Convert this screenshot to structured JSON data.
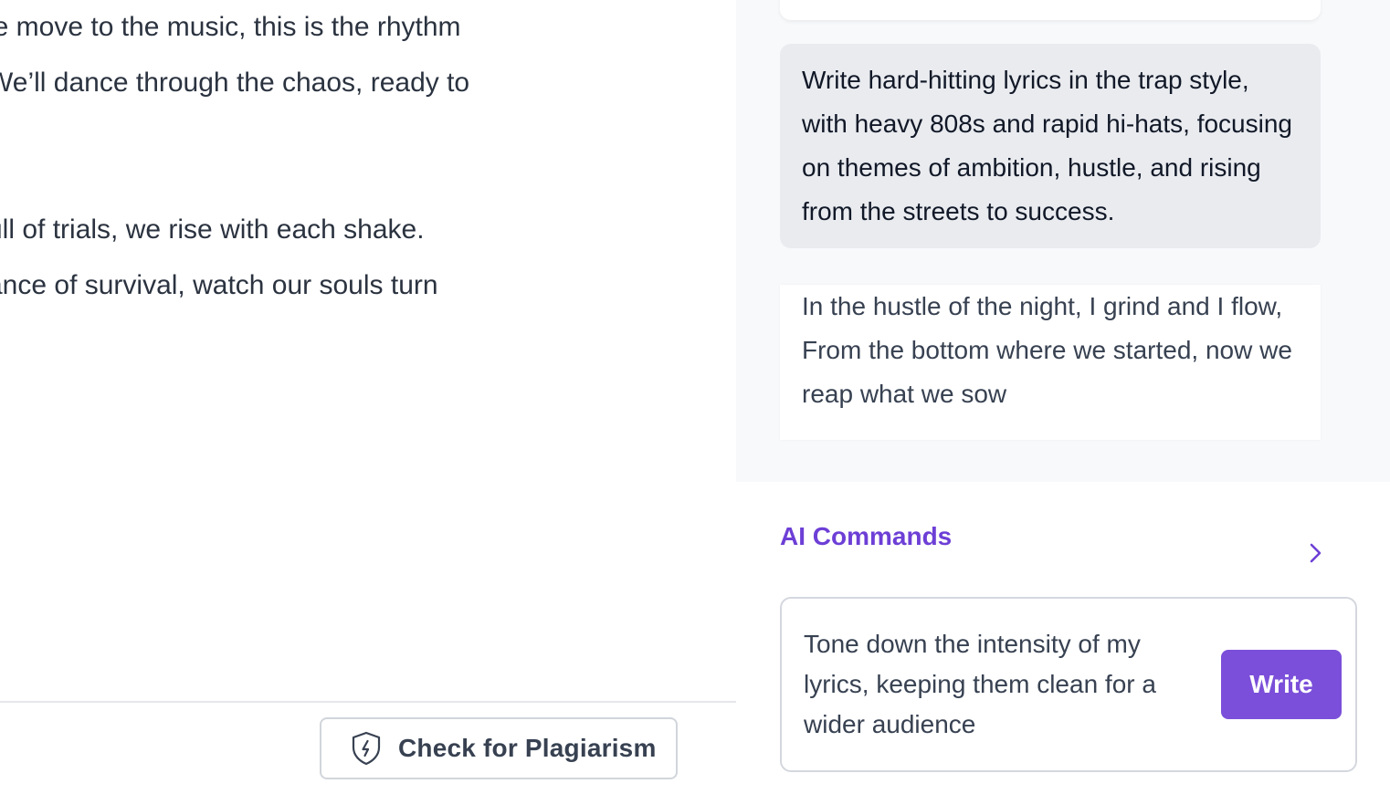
{
  "editor": {
    "lines": [
      "’e move to the music, this is the rhythm",
      "We’ll dance through the chaos, ready to",
      "ull of trials, we rise with each shake.",
      "ance of survival, watch our souls turn"
    ],
    "plagiarism_button": {
      "label": "Check for Plagiarism",
      "icon": "shield-bolt-icon"
    }
  },
  "chat": {
    "prompt": "Write hard-hitting lyrics in the trap style, with heavy 808s and rapid hi-hats, focusing on themes of ambition, hustle, and rising from the streets to success.",
    "response_lines": [
      "In the hustle of the night, I grind and I flow,",
      "From the bottom where we started, now we reap what we sow"
    ]
  },
  "ai_commands": {
    "title": "AI Commands",
    "chevron_icon": "chevron-right-icon",
    "input_value": "Tone down the intensity of my lyrics, keeping them clean for a wider audience",
    "write_label": "Write"
  },
  "colors": {
    "accent": "#7b4fd9",
    "accent_text": "#6d3fd6",
    "chat_bg": "#f8f9fb",
    "prompt_bg": "#e9ebef"
  }
}
